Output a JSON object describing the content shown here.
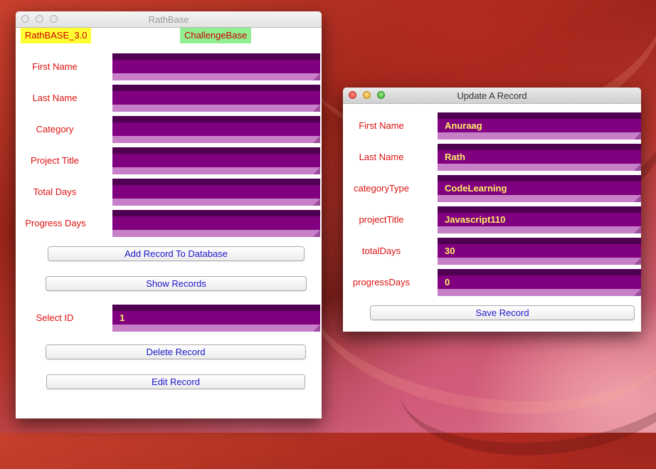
{
  "main_window": {
    "title": "RathBase",
    "version_badge": "RathBASE_3.0",
    "challenge_badge": "ChallengeBase",
    "fields": [
      {
        "label": "First Name",
        "value": ""
      },
      {
        "label": "Last Name",
        "value": ""
      },
      {
        "label": "Category",
        "value": ""
      },
      {
        "label": "Project Title",
        "value": ""
      },
      {
        "label": "Total Days",
        "value": ""
      },
      {
        "label": "Progress Days",
        "value": ""
      }
    ],
    "add_button": "Add Record To Database",
    "show_button": "Show Records",
    "select_id_label": "Select ID",
    "select_id_value": "1",
    "delete_button": "Delete Record",
    "edit_button": "Edit Record"
  },
  "update_window": {
    "title": "Update A Record",
    "fields": [
      {
        "label": "First Name",
        "value": "Anuraag"
      },
      {
        "label": "Last Name",
        "value": "Rath"
      },
      {
        "label": "categoryType",
        "value": "CodeLearning"
      },
      {
        "label": "projectTitle",
        "value": "Javascript110"
      },
      {
        "label": "totalDays",
        "value": "30"
      },
      {
        "label": "progressDays",
        "value": "0"
      }
    ],
    "save_button": "Save Record"
  },
  "colors": {
    "label_red": "#dd1111",
    "field_purple": "#800080",
    "field_text": "#ffee66",
    "button_text": "#1b16c8",
    "version_badge_bg": "#ffff33",
    "challenge_badge_bg": "#90ee90"
  }
}
